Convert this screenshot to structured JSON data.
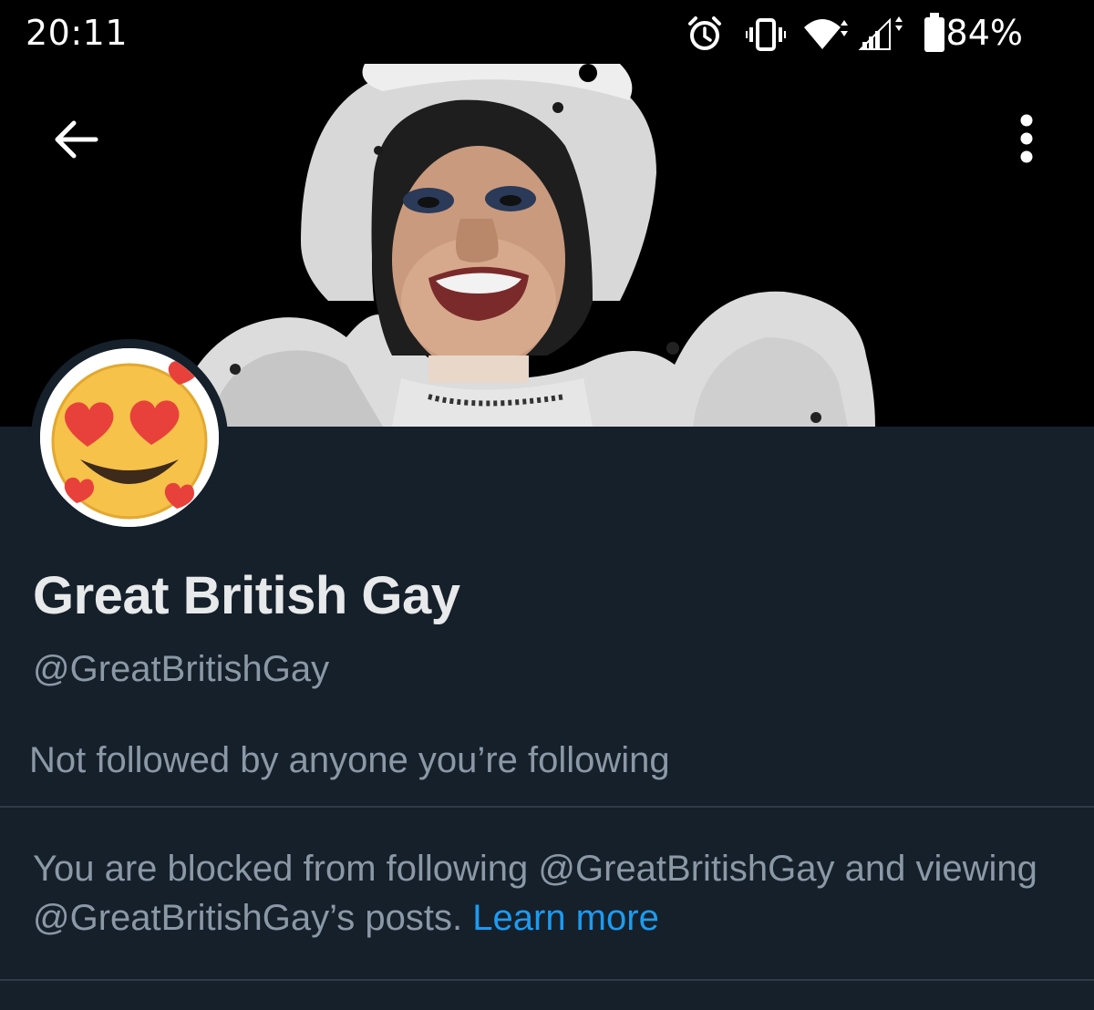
{
  "status_bar": {
    "time": "20:11",
    "battery": "84%",
    "icons": [
      "alarm-icon",
      "vibrate-icon",
      "wifi-icon",
      "signal-icon",
      "battery-icon"
    ]
  },
  "header": {
    "back_icon": "arrow-left-icon",
    "more_icon": "more-vertical-icon"
  },
  "profile": {
    "avatar": "smiling-face-with-heart-eyes-emoji",
    "display_name": "Great British Gay",
    "handle": "@GreatBritishGay",
    "followers_note": "Not followed by anyone you’re following"
  },
  "blocked_notice": {
    "text": "You are blocked from following @GreatBritishGay and viewing @GreatBritishGay’s posts.",
    "link": "Learn more"
  },
  "colors": {
    "background": "#15202b",
    "text_primary": "#e7e9ea",
    "text_secondary": "#8b98a5",
    "link": "#1d9bf0",
    "divider": "#2f3b47"
  }
}
